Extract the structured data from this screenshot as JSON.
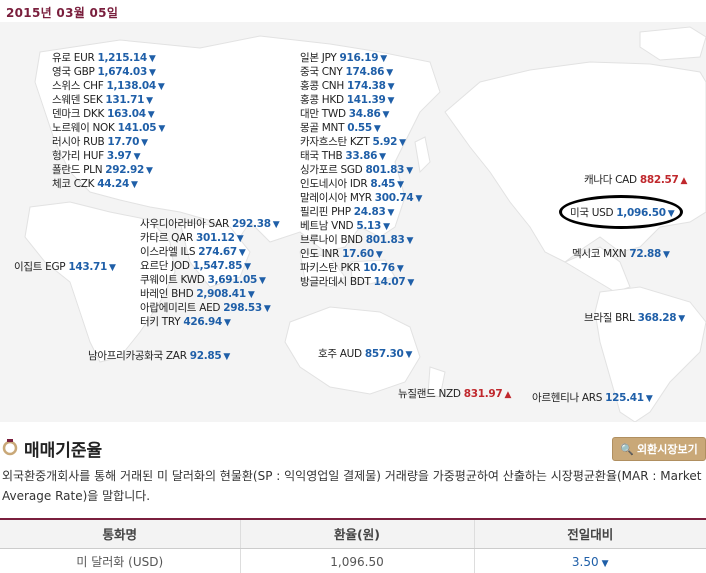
{
  "date": "2015년 03월 05일",
  "rates": [
    {
      "label": "유로 EUR",
      "value": "1,215.14",
      "dir": "down"
    },
    {
      "label": "영국 GBP",
      "value": "1,674.03",
      "dir": "down"
    },
    {
      "label": "스위스 CHF",
      "value": "1,138.04",
      "dir": "down"
    },
    {
      "label": "스웨덴 SEK",
      "value": "131.71",
      "dir": "down"
    },
    {
      "label": "덴마크 DKK",
      "value": "163.04",
      "dir": "down"
    },
    {
      "label": "노르웨이 NOK",
      "value": "141.05",
      "dir": "down"
    },
    {
      "label": "러시아 RUB",
      "value": "17.70",
      "dir": "down"
    },
    {
      "label": "헝가리 HUF",
      "value": "3.97",
      "dir": "down"
    },
    {
      "label": "폴란드 PLN",
      "value": "292.92",
      "dir": "down"
    },
    {
      "label": "체코 CZK",
      "value": "44.24",
      "dir": "down"
    },
    {
      "label": "일본 JPY",
      "value": "916.19",
      "dir": "down"
    },
    {
      "label": "중국 CNY",
      "value": "174.86",
      "dir": "down"
    },
    {
      "label": "홍콩 CNH",
      "value": "174.38",
      "dir": "down"
    },
    {
      "label": "홍콩 HKD",
      "value": "141.39",
      "dir": "down"
    },
    {
      "label": "대만 TWD",
      "value": "34.86",
      "dir": "down"
    },
    {
      "label": "몽골 MNT",
      "value": "0.55",
      "dir": "down"
    },
    {
      "label": "카자흐스탄 KZT",
      "value": "5.92",
      "dir": "down"
    },
    {
      "label": "태국 THB",
      "value": "33.86",
      "dir": "down"
    },
    {
      "label": "싱가포르 SGD",
      "value": "801.83",
      "dir": "down"
    },
    {
      "label": "인도네시아 IDR",
      "value": "8.45",
      "dir": "down"
    },
    {
      "label": "말레이시아 MYR",
      "value": "300.74",
      "dir": "down"
    },
    {
      "label": "필리핀 PHP",
      "value": "24.83",
      "dir": "down"
    },
    {
      "label": "베트남 VND",
      "value": "5.13",
      "dir": "down"
    },
    {
      "label": "브루나이 BND",
      "value": "801.83",
      "dir": "down"
    },
    {
      "label": "인도 INR",
      "value": "17.60",
      "dir": "down"
    },
    {
      "label": "파키스탄 PKR",
      "value": "10.76",
      "dir": "down"
    },
    {
      "label": "방글라데시 BDT",
      "value": "14.07",
      "dir": "down"
    },
    {
      "label": "사우디아라비아 SAR",
      "value": "292.38",
      "dir": "down"
    },
    {
      "label": "카타르 QAR",
      "value": "301.12",
      "dir": "down"
    },
    {
      "label": "이스라엘 ILS",
      "value": "274.67",
      "dir": "down"
    },
    {
      "label": "요르단 JOD",
      "value": "1,547.85",
      "dir": "down"
    },
    {
      "label": "쿠웨이트 KWD",
      "value": "3,691.05",
      "dir": "down"
    },
    {
      "label": "바레인 BHD",
      "value": "2,908.41",
      "dir": "down"
    },
    {
      "label": "아랍에미리트 AED",
      "value": "298.53",
      "dir": "down"
    },
    {
      "label": "터키 TRY",
      "value": "426.94",
      "dir": "down"
    },
    {
      "label": "이집트 EGP",
      "value": "143.71",
      "dir": "down"
    },
    {
      "label": "남아프리카공화국 ZAR",
      "value": "92.85",
      "dir": "down"
    },
    {
      "label": "호주 AUD",
      "value": "857.30",
      "dir": "down"
    },
    {
      "label": "뉴질랜드 NZD",
      "value": "831.97",
      "dir": "up"
    },
    {
      "label": "캐나다 CAD",
      "value": "882.57",
      "dir": "up"
    },
    {
      "label": "미국 USD",
      "value": "1,096.50",
      "dir": "down"
    },
    {
      "label": "멕시코 MXN",
      "value": "72.88",
      "dir": "down"
    },
    {
      "label": "브라질 BRL",
      "value": "368.28",
      "dir": "down"
    },
    {
      "label": "아르헨티나 ARS",
      "value": "125.41",
      "dir": "down"
    }
  ],
  "section": {
    "title": "매매기준율",
    "button_label": "외환시장보기",
    "description": "외국환중개회사를 통해 거래된 미 달러화의 현물환(SP : 익익영업일 결제물) 거래량을 가중평균하여 산출하는 시장평균환율(MAR : Market Average Rate)을 말합니다."
  },
  "table": {
    "headers": [
      "통화명",
      "환율(원)",
      "전일대비"
    ],
    "rows": [
      {
        "currency": "미 달러화 (USD)",
        "rate": "1,096.50",
        "change": "3.50",
        "dir": "down"
      }
    ]
  },
  "colors": {
    "up": "#c0282d",
    "down": "#1f5fa8",
    "accent": "#7a1f3d",
    "button": "#c9a878"
  }
}
